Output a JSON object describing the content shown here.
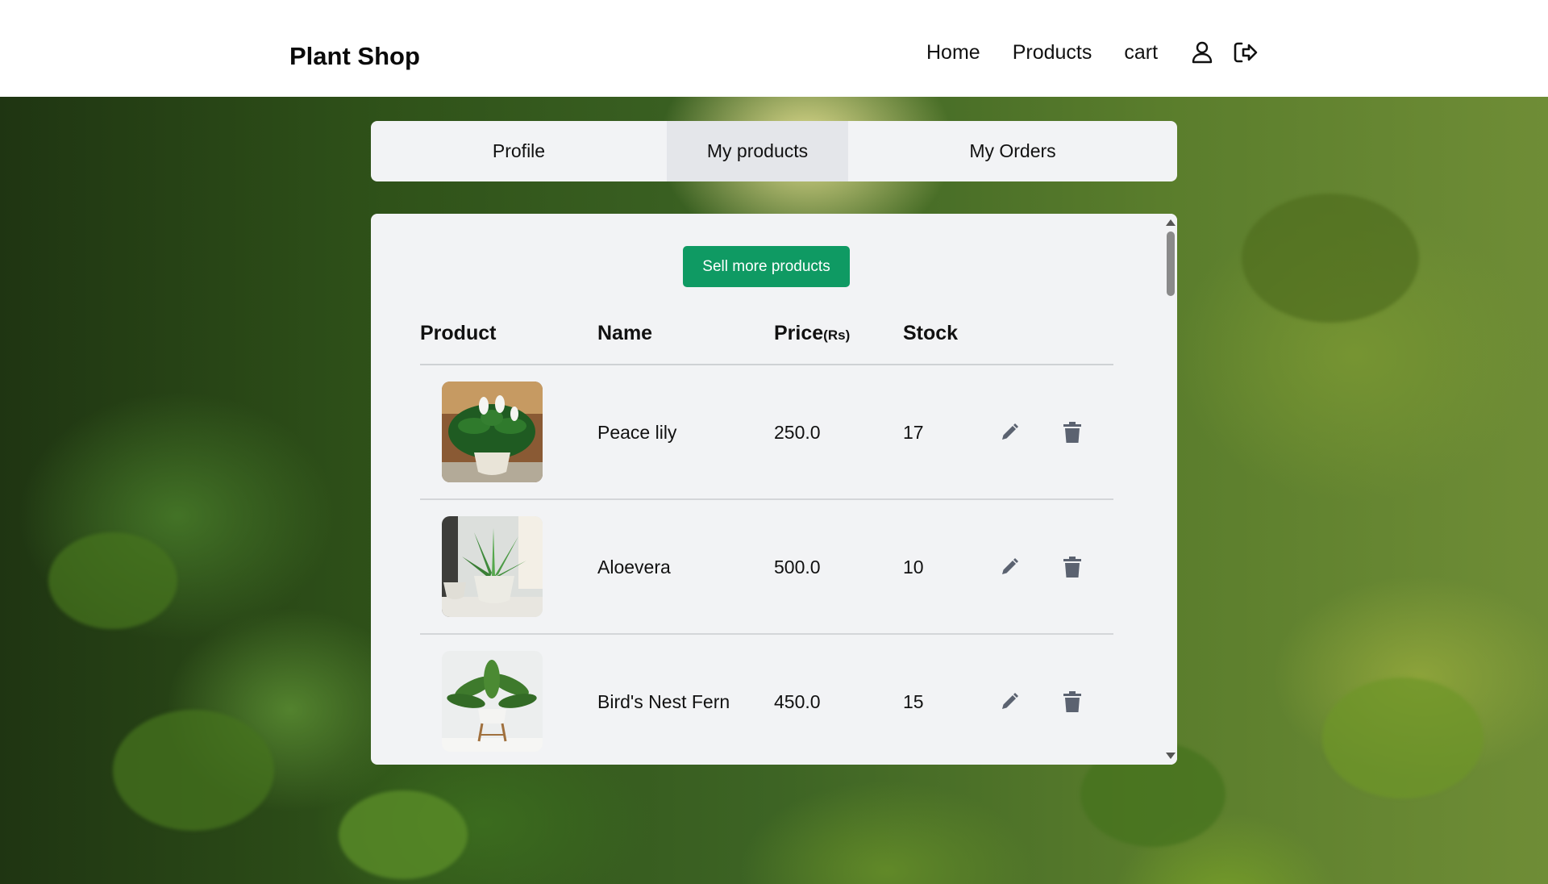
{
  "brand": "Plant Shop",
  "nav": {
    "home": "Home",
    "products": "Products",
    "cart": "cart",
    "profile_icon": "user-icon",
    "logout_icon": "logout-icon"
  },
  "tabs": [
    {
      "label": "Profile",
      "active": false
    },
    {
      "label": "My products",
      "active": true
    },
    {
      "label": "My Orders",
      "active": false
    }
  ],
  "sell_button": "Sell more products",
  "table": {
    "headers": {
      "product": "Product",
      "name": "Name",
      "price": "Price",
      "price_unit": "(Rs)",
      "stock": "Stock"
    },
    "rows": [
      {
        "name": "Peace lily",
        "price": "250.0",
        "stock": "17"
      },
      {
        "name": "Aloevera",
        "price": "500.0",
        "stock": "10"
      },
      {
        "name": "Bird's Nest Fern",
        "price": "450.0",
        "stock": "15"
      }
    ]
  },
  "icons": {
    "edit": "pencil-icon",
    "delete": "trash-icon"
  },
  "colors": {
    "accent": "#0f9a63",
    "panel": "#f2f3f5",
    "active_tab": "#e4e6ea",
    "icon": "#5b6270"
  }
}
